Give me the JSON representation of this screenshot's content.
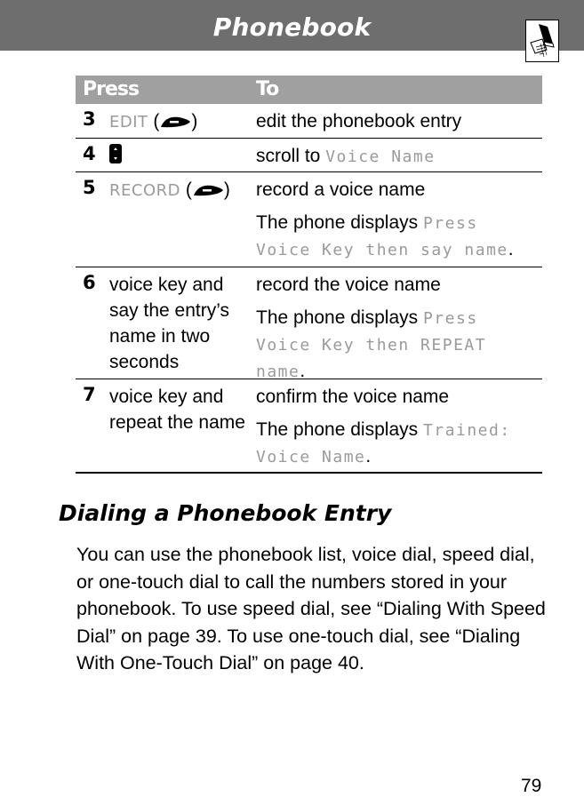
{
  "header": {
    "title": "Phonebook",
    "section_icon": "phonebook-icon"
  },
  "table": {
    "columns": [
      "Press",
      "To"
    ],
    "rows": [
      {
        "step": "3",
        "press": {
          "softkey": "EDIT",
          "key_icon": "right-soft-key-icon"
        },
        "to": [
          {
            "text": "edit the phonebook entry"
          }
        ]
      },
      {
        "step": "4",
        "press": {
          "key_icon": "scroll-key-icon"
        },
        "to": [
          {
            "text": "scroll to ",
            "display": "Voice Name"
          }
        ]
      },
      {
        "step": "5",
        "press": {
          "softkey": "RECORD",
          "key_icon": "right-soft-key-icon"
        },
        "to": [
          {
            "text": "record a voice name"
          },
          {
            "text": "The phone displays ",
            "display": "Press Voice Key then say name",
            "suffix": "."
          }
        ]
      },
      {
        "step": "6",
        "press": {
          "text": "voice key and say the entry’s name in two seconds"
        },
        "to": [
          {
            "text": "record the voice name"
          },
          {
            "text": "The phone displays ",
            "display": "Press Voice Key then REPEAT name",
            "suffix": "."
          }
        ]
      },
      {
        "step": "7",
        "press": {
          "text": "voice key and repeat the name"
        },
        "to": [
          {
            "text": "confirm the voice name"
          },
          {
            "text": "The phone displays ",
            "display": "Trained: Voice Name",
            "suffix": "."
          }
        ]
      }
    ]
  },
  "section": {
    "heading": "Dialing a Phonebook Entry",
    "body": "You can use the phonebook list, voice dial, speed dial, or one-touch dial to call the numbers stored in your phonebook. To use speed dial, see “Dialing With Speed Dial” on page 39. To use one-touch dial, see “Dialing With One-Touch Dial” on page 40."
  },
  "page_number": "79",
  "colors": {
    "header_bar": "#6e6e6e",
    "table_header": "#a0a0a0",
    "display_text": "#9a9a9a"
  }
}
